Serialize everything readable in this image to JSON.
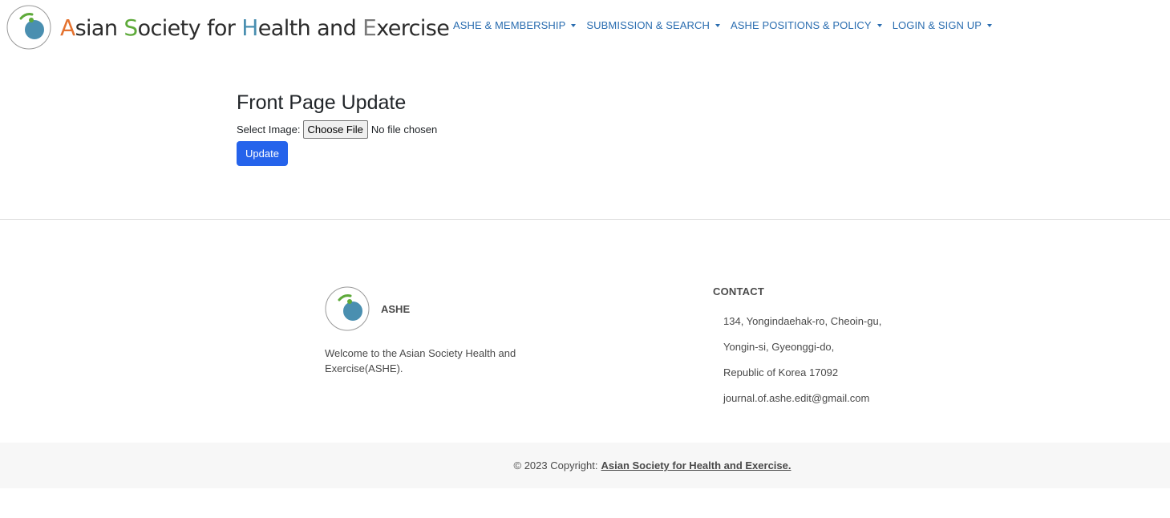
{
  "header": {
    "brand": {
      "parts": [
        {
          "initial": "A",
          "rest": "sian ",
          "color": "#e4722f"
        },
        {
          "initial": "S",
          "rest": "ociety for ",
          "color": "#5eaa3a"
        },
        {
          "initial": "H",
          "rest": "ealth and ",
          "color": "#4a8fb0"
        },
        {
          "initial": "E",
          "rest": "xercise",
          "color": "#7a7a7a"
        }
      ]
    },
    "nav": [
      {
        "label": "ASHE & MEMBERSHIP"
      },
      {
        "label": "SUBMISSION & SEARCH"
      },
      {
        "label": "ASHE POSITIONS & POLICY"
      },
      {
        "label": "LOGIN & SIGN UP"
      }
    ]
  },
  "main": {
    "title": "Front Page Update",
    "file_label": "Select Image:",
    "choose_button": "Choose File",
    "file_status": "No file chosen",
    "update_button": "Update"
  },
  "footer": {
    "name": "ASHE",
    "welcome": "Welcome to the Asian Society Health and Exercise(ASHE).",
    "contact_title": "CONTACT",
    "contact_lines": [
      "134, Yongindaehak-ro, Cheoin-gu,",
      "Yongin-si, Gyeonggi-do,",
      "Republic of Korea 17092",
      "journal.of.ashe.edit@gmail.com"
    ],
    "copyright_prefix": "© 2023 Copyright:",
    "copyright_link": "Asian Society for Health and Exercise."
  },
  "colors": {
    "nav_link": "#2a6db0",
    "primary_button": "#2563eb",
    "logo_orange": "#e4722f",
    "logo_blue": "#4a8fb0",
    "logo_green": "#5eaa3a"
  }
}
